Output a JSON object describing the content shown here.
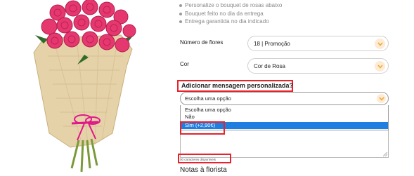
{
  "features": [
    "Personalize o bouquet de rosas abaixo",
    "Bouquet feito no dia da entrega",
    "Entrega garantida no dia indicado"
  ],
  "flowers": {
    "label": "Número de flores",
    "value": "18 | Promoção",
    "icon": "chevron-down-icon"
  },
  "color": {
    "label": "Cor",
    "value": "Cor de Rosa",
    "icon": "chevron-down-icon"
  },
  "message": {
    "heading": "Adicionar mensagem personalizada?",
    "selected": "Escolha uma opção",
    "options": [
      "Escolha uma opção",
      "Não",
      "Sim (+2,90€)"
    ],
    "highlighted_option": "Sim (+2,90€)"
  },
  "char_count": "00 caracteres disponíveis",
  "notes_title": "Notas à florista",
  "colors": {
    "highlight": "#e8212b",
    "accent": "#f3a533",
    "option_highlight": "#1e7fe1"
  }
}
